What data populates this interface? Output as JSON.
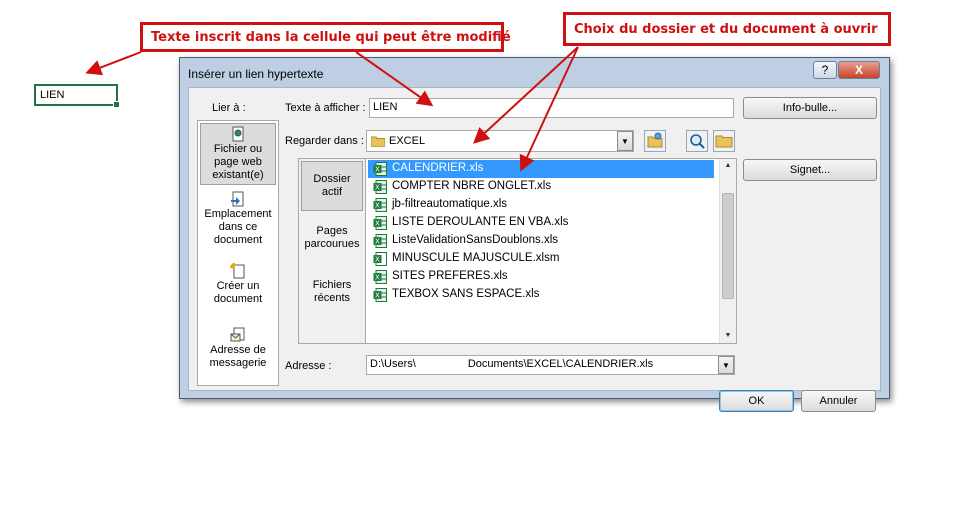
{
  "annotations": {
    "left": "Texte inscrit dans la cellule qui peut être modifié",
    "right": "Choix du dossier et du document à ouvrir"
  },
  "sheet": {
    "cell_value": "LIEN"
  },
  "dialog": {
    "title": "Insérer un lien hypertexte",
    "help_label": "?",
    "close_label": "X",
    "link_to_label": "Lier à :",
    "sidebar": [
      {
        "line1": "Fichier ou",
        "line2": "page web",
        "line3": "existant(e)"
      },
      {
        "line1": "Emplacement",
        "line2": "dans ce",
        "line3": "document"
      },
      {
        "line1": "Créer un",
        "line2": "document"
      },
      {
        "line1": "Adresse de",
        "line2": "messagerie"
      }
    ],
    "text_to_display_label": "Texte à afficher :",
    "text_to_display_value": "LIEN",
    "screentip_label": "Info-bulle...",
    "look_in_label": "Regarder dans :",
    "look_in_value": "EXCEL",
    "bookmark_label": "Signet...",
    "tabs": [
      {
        "line1": "Dossier",
        "line2": "actif"
      },
      {
        "line1": "Pages",
        "line2": "parcourues"
      },
      {
        "line1": "Fichiers",
        "line2": "récents"
      }
    ],
    "files": [
      "CALENDRIER.xls",
      "COMPTER NBRE ONGLET.xls",
      "jb-filtreautomatique.xls",
      "LISTE DEROULANTE EN VBA.xls",
      "ListeValidationSansDoublons.xls",
      "MINUSCULE MAJUSCULE.xlsm",
      "SITES PREFERES.xls",
      "TEXBOX SANS ESPACE.xls"
    ],
    "address_label": "Adresse :",
    "address_prefix": "D:\\Users\\",
    "address_suffix": "Documents\\EXCEL\\CALENDRIER.xls",
    "ok_label": "OK",
    "cancel_label": "Annuler",
    "colors": {
      "selection": "#3399ff",
      "annotation": "#d01010",
      "excel_green": "#217346"
    }
  }
}
